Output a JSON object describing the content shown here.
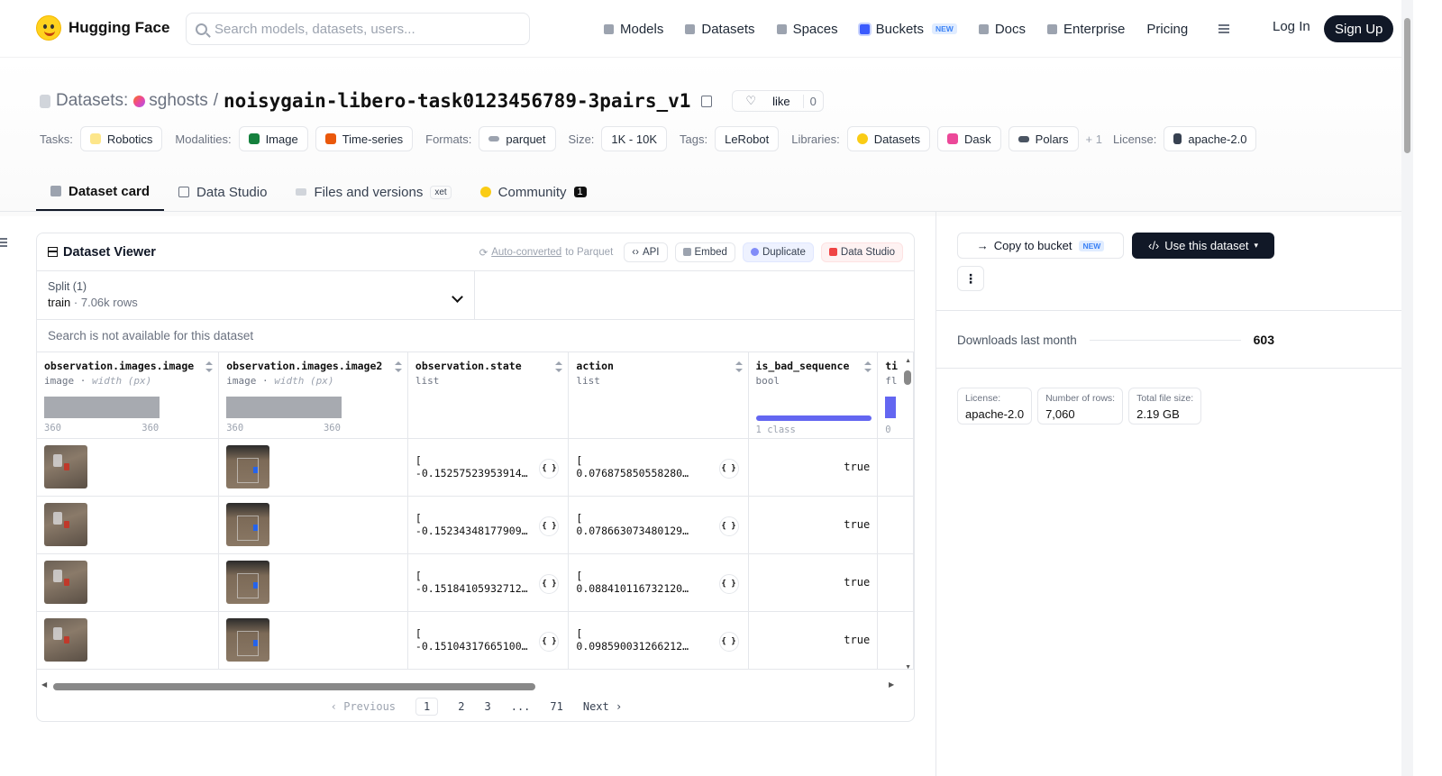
{
  "nav": {
    "brand": "Hugging Face",
    "search_placeholder": "Search models, datasets, users...",
    "links": [
      {
        "label": "Models",
        "icon": "models-icon"
      },
      {
        "label": "Datasets",
        "icon": "datasets-icon"
      },
      {
        "label": "Spaces",
        "icon": "spaces-icon"
      },
      {
        "label": "Buckets",
        "icon": "buckets-icon",
        "badge": "NEW"
      },
      {
        "label": "Docs",
        "icon": "docs-icon"
      },
      {
        "label": "Enterprise",
        "icon": "enterprise-icon"
      },
      {
        "label": "Pricing"
      }
    ],
    "login": "Log In",
    "signup": "Sign Up"
  },
  "dataset": {
    "crumb": "Datasets:",
    "owner": "sghosts",
    "separator": "/",
    "name": "noisygain-libero-task0123456789-3pairs_v1",
    "like_label": "like",
    "like_count": "0"
  },
  "tags": {
    "tasks_label": "Tasks:",
    "tasks": [
      "Robotics"
    ],
    "modalities_label": "Modalities:",
    "modalities": [
      "Image",
      "Time-series"
    ],
    "formats_label": "Formats:",
    "formats": [
      "parquet"
    ],
    "size_label": "Size:",
    "size": "1K - 10K",
    "tags_label": "Tags:",
    "tags": [
      "LeRobot"
    ],
    "libraries_label": "Libraries:",
    "libraries": [
      "Datasets",
      "Dask",
      "Polars"
    ],
    "more": "+ 1",
    "license_label": "License:",
    "license": "apache-2.0"
  },
  "tabs": {
    "card": "Dataset card",
    "studio": "Data Studio",
    "files": "Files and versions",
    "xet": "xet",
    "community": "Community",
    "community_count": "1"
  },
  "viewer": {
    "title": "Dataset Viewer",
    "auto_link": "Auto-converted",
    "auto_rest": " to Parquet",
    "api": "API",
    "embed": "Embed",
    "duplicate": "Duplicate",
    "data_studio": "Data Studio",
    "split_label": "Split (1)",
    "split_value": "train",
    "split_sep": " · ",
    "split_rows": "7.06k rows",
    "search_note": "Search is not available for this dataset",
    "columns": [
      {
        "name": "observation.images.image",
        "type": "image",
        "sub": "width (px)",
        "min": "360",
        "max": "360"
      },
      {
        "name": "observation.images.image2",
        "type": "image",
        "sub": "width (px)",
        "min": "360",
        "max": "360"
      },
      {
        "name": "observation.state",
        "type": "list"
      },
      {
        "name": "action",
        "type": "list"
      },
      {
        "name": "is_bad_sequence",
        "type": "bool",
        "classes": "1 class"
      },
      {
        "name": "ti",
        "type": "fl",
        "min": "0"
      }
    ],
    "rows": [
      {
        "state": "[\n-0.15257523953914...",
        "action": "[\n0.07687585055828094,...",
        "bad": "true"
      },
      {
        "state": "[\n-0.15234348177909...",
        "action": "[\n0.07866307348012924,...",
        "bad": "true"
      },
      {
        "state": "[\n-0.15184105932712...",
        "action": "[\n0.08841011673212051,...",
        "bad": "true"
      },
      {
        "state": "[\n-0.15104317665100...",
        "action": "[\n0.09859003126621246,...",
        "bad": "true"
      }
    ],
    "json_label": "{ }",
    "pager": {
      "prev": "‹ Previous",
      "pages": [
        "1",
        "2",
        "3",
        "...",
        "71"
      ],
      "next": "Next ›"
    }
  },
  "sidebar": {
    "copy_bucket": "Copy to bucket",
    "new_badge": "NEW",
    "use_dataset": "Use this dataset",
    "downloads_label": "Downloads last month",
    "downloads_value": "603",
    "stats": [
      {
        "label": "License:",
        "value": "apache-2.0"
      },
      {
        "label": "Number of rows:",
        "value": "7,060"
      },
      {
        "label": "Total file size:",
        "value": "2.19 GB"
      }
    ]
  }
}
